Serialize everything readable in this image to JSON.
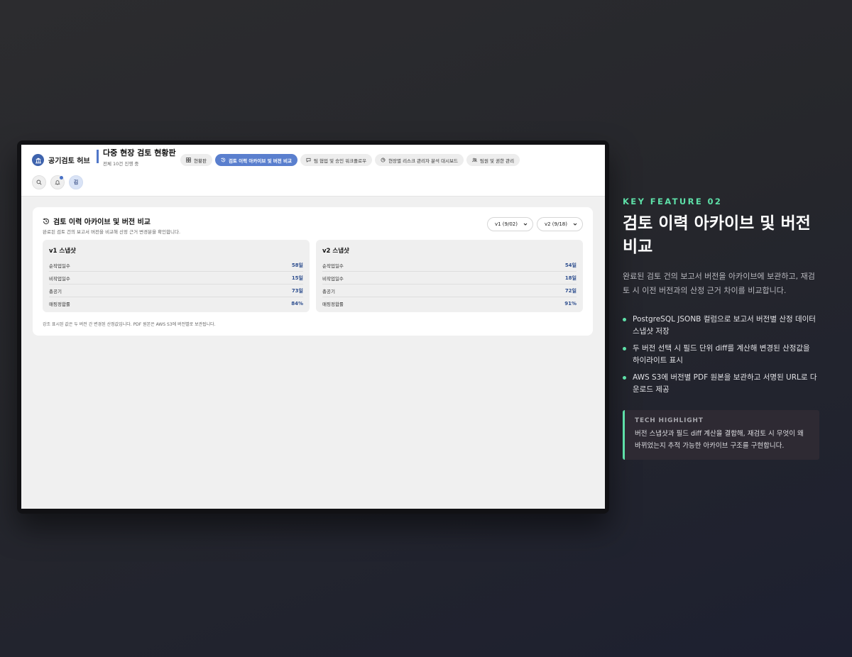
{
  "app": {
    "brand": "공기검토 허브",
    "title": "다중 현장 검토 현황판",
    "subtitle": "전체 10건 진행 중",
    "avatar": "김"
  },
  "nav": {
    "tabs": [
      {
        "label": "현황판",
        "icon": "grid-icon",
        "active": false
      },
      {
        "label": "검토 이력 아카이브 및 버전 비교",
        "icon": "history-icon",
        "active": true
      },
      {
        "label": "팀 협업 및 승인 워크플로우",
        "icon": "chat-icon",
        "active": false
      },
      {
        "label": "현장별 리스크 관리자 분석 대시보드",
        "icon": "analytics-icon",
        "active": false
      },
      {
        "label": "팀원 및 권한 관리",
        "icon": "team-icon",
        "active": false
      }
    ]
  },
  "archive": {
    "title": "검토 이력 아카이브 및 버전 비교",
    "description": "완료된 검토 건의 보고서 버전을 비교해 산정 근거 변경분을 확인합니다.",
    "select_a": "v1 (9/02)",
    "select_b": "v2 (9/18)",
    "snapshots": [
      {
        "title": "v1 스냅샷",
        "rows": [
          {
            "label": "순작업일수",
            "value": "58일"
          },
          {
            "label": "비작업일수",
            "value": "15일"
          },
          {
            "label": "총공기",
            "value": "73일"
          },
          {
            "label": "매핑정합률",
            "value": "84%"
          }
        ]
      },
      {
        "title": "v2 스냅샷",
        "rows": [
          {
            "label": "순작업일수",
            "value": "54일"
          },
          {
            "label": "비작업일수",
            "value": "18일"
          },
          {
            "label": "총공기",
            "value": "72일"
          },
          {
            "label": "매핑정합률",
            "value": "91%"
          }
        ]
      }
    ],
    "footnote": "강조 표시된 값은 두 버전 간 변경된 산정값입니다. PDF 원본은 AWS S3에 버전별로 보관됩니다."
  },
  "feature": {
    "kicker": "KEY FEATURE 02",
    "headline": "검토 이력 아카이브 및 버전 비교",
    "lead": "완료된 검토 건의 보고서 버전을 아카이브에 보관하고, 재검토 시 이전 버전과의 산정 근거 차이를 비교합니다.",
    "bullets": [
      "PostgreSQL JSONB 컬럼으로 보고서 버전별 산정 데이터 스냅샷 저장",
      "두 버전 선택 시 필드 단위 diff를 계산해 변경된 산정값을 하이라이트 표시",
      "AWS S3에 버전별 PDF 원본을 보관하고 서명된 URL로 다운로드 제공"
    ],
    "tech_label": "TECH HIGHLIGHT",
    "tech_body": "버전 스냅샷과 필드 diff 계산을 결합해, 재검토 시 무엇이 왜 바뀌었는지 추적 가능한 아카이브 구조를 구현합니다."
  },
  "colors": {
    "accent": "#5a7fce",
    "feature_accent": "#5ee0a8",
    "value_text": "#2f4f8f"
  }
}
